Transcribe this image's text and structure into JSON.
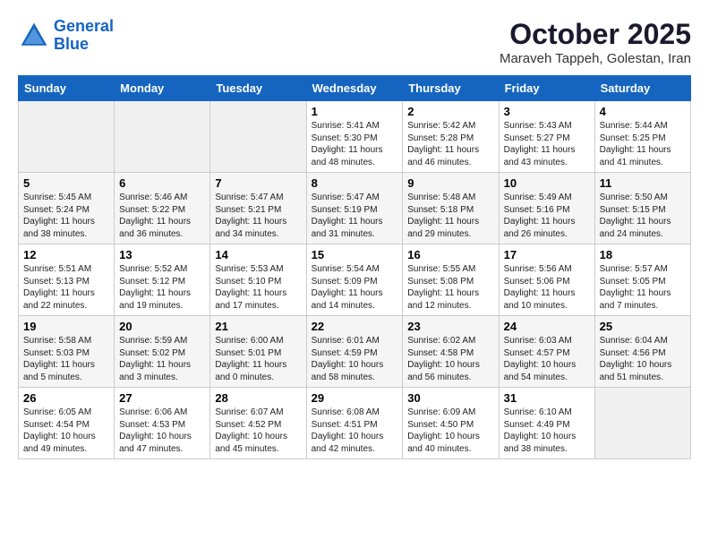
{
  "header": {
    "logo_line1": "General",
    "logo_line2": "Blue",
    "month": "October 2025",
    "location": "Maraveh Tappeh, Golestan, Iran"
  },
  "days_of_week": [
    "Sunday",
    "Monday",
    "Tuesday",
    "Wednesday",
    "Thursday",
    "Friday",
    "Saturday"
  ],
  "weeks": [
    [
      {
        "day": "",
        "content": ""
      },
      {
        "day": "",
        "content": ""
      },
      {
        "day": "",
        "content": ""
      },
      {
        "day": "1",
        "content": "Sunrise: 5:41 AM\nSunset: 5:30 PM\nDaylight: 11 hours\nand 48 minutes."
      },
      {
        "day": "2",
        "content": "Sunrise: 5:42 AM\nSunset: 5:28 PM\nDaylight: 11 hours\nand 46 minutes."
      },
      {
        "day": "3",
        "content": "Sunrise: 5:43 AM\nSunset: 5:27 PM\nDaylight: 11 hours\nand 43 minutes."
      },
      {
        "day": "4",
        "content": "Sunrise: 5:44 AM\nSunset: 5:25 PM\nDaylight: 11 hours\nand 41 minutes."
      }
    ],
    [
      {
        "day": "5",
        "content": "Sunrise: 5:45 AM\nSunset: 5:24 PM\nDaylight: 11 hours\nand 38 minutes."
      },
      {
        "day": "6",
        "content": "Sunrise: 5:46 AM\nSunset: 5:22 PM\nDaylight: 11 hours\nand 36 minutes."
      },
      {
        "day": "7",
        "content": "Sunrise: 5:47 AM\nSunset: 5:21 PM\nDaylight: 11 hours\nand 34 minutes."
      },
      {
        "day": "8",
        "content": "Sunrise: 5:47 AM\nSunset: 5:19 PM\nDaylight: 11 hours\nand 31 minutes."
      },
      {
        "day": "9",
        "content": "Sunrise: 5:48 AM\nSunset: 5:18 PM\nDaylight: 11 hours\nand 29 minutes."
      },
      {
        "day": "10",
        "content": "Sunrise: 5:49 AM\nSunset: 5:16 PM\nDaylight: 11 hours\nand 26 minutes."
      },
      {
        "day": "11",
        "content": "Sunrise: 5:50 AM\nSunset: 5:15 PM\nDaylight: 11 hours\nand 24 minutes."
      }
    ],
    [
      {
        "day": "12",
        "content": "Sunrise: 5:51 AM\nSunset: 5:13 PM\nDaylight: 11 hours\nand 22 minutes."
      },
      {
        "day": "13",
        "content": "Sunrise: 5:52 AM\nSunset: 5:12 PM\nDaylight: 11 hours\nand 19 minutes."
      },
      {
        "day": "14",
        "content": "Sunrise: 5:53 AM\nSunset: 5:10 PM\nDaylight: 11 hours\nand 17 minutes."
      },
      {
        "day": "15",
        "content": "Sunrise: 5:54 AM\nSunset: 5:09 PM\nDaylight: 11 hours\nand 14 minutes."
      },
      {
        "day": "16",
        "content": "Sunrise: 5:55 AM\nSunset: 5:08 PM\nDaylight: 11 hours\nand 12 minutes."
      },
      {
        "day": "17",
        "content": "Sunrise: 5:56 AM\nSunset: 5:06 PM\nDaylight: 11 hours\nand 10 minutes."
      },
      {
        "day": "18",
        "content": "Sunrise: 5:57 AM\nSunset: 5:05 PM\nDaylight: 11 hours\nand 7 minutes."
      }
    ],
    [
      {
        "day": "19",
        "content": "Sunrise: 5:58 AM\nSunset: 5:03 PM\nDaylight: 11 hours\nand 5 minutes."
      },
      {
        "day": "20",
        "content": "Sunrise: 5:59 AM\nSunset: 5:02 PM\nDaylight: 11 hours\nand 3 minutes."
      },
      {
        "day": "21",
        "content": "Sunrise: 6:00 AM\nSunset: 5:01 PM\nDaylight: 11 hours\nand 0 minutes."
      },
      {
        "day": "22",
        "content": "Sunrise: 6:01 AM\nSunset: 4:59 PM\nDaylight: 10 hours\nand 58 minutes."
      },
      {
        "day": "23",
        "content": "Sunrise: 6:02 AM\nSunset: 4:58 PM\nDaylight: 10 hours\nand 56 minutes."
      },
      {
        "day": "24",
        "content": "Sunrise: 6:03 AM\nSunset: 4:57 PM\nDaylight: 10 hours\nand 54 minutes."
      },
      {
        "day": "25",
        "content": "Sunrise: 6:04 AM\nSunset: 4:56 PM\nDaylight: 10 hours\nand 51 minutes."
      }
    ],
    [
      {
        "day": "26",
        "content": "Sunrise: 6:05 AM\nSunset: 4:54 PM\nDaylight: 10 hours\nand 49 minutes."
      },
      {
        "day": "27",
        "content": "Sunrise: 6:06 AM\nSunset: 4:53 PM\nDaylight: 10 hours\nand 47 minutes."
      },
      {
        "day": "28",
        "content": "Sunrise: 6:07 AM\nSunset: 4:52 PM\nDaylight: 10 hours\nand 45 minutes."
      },
      {
        "day": "29",
        "content": "Sunrise: 6:08 AM\nSunset: 4:51 PM\nDaylight: 10 hours\nand 42 minutes."
      },
      {
        "day": "30",
        "content": "Sunrise: 6:09 AM\nSunset: 4:50 PM\nDaylight: 10 hours\nand 40 minutes."
      },
      {
        "day": "31",
        "content": "Sunrise: 6:10 AM\nSunset: 4:49 PM\nDaylight: 10 hours\nand 38 minutes."
      },
      {
        "day": "",
        "content": ""
      }
    ]
  ]
}
